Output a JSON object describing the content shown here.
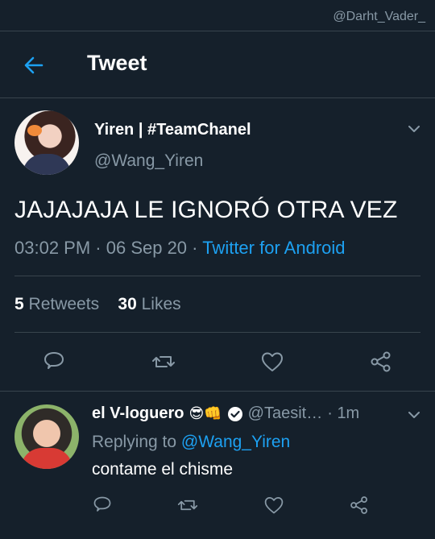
{
  "watermark": "@Darht_Vader_",
  "header": {
    "title": "Tweet"
  },
  "tweet": {
    "author_name": "Yiren | #TeamChanel",
    "author_handle": "@Wang_Yiren",
    "text": "JAJAJAJA LE IGNORÓ OTRA VEZ",
    "time": "03:02 PM",
    "date": "06 Sep 20",
    "source": "Twitter for Android",
    "retweets_count": "5",
    "retweets_label": "Retweets",
    "likes_count": "30",
    "likes_label": "Likes"
  },
  "reply": {
    "author_name": "el V-loguero",
    "emojis": "😎👊",
    "author_handle": "@Taesit…",
    "time": "1m",
    "replying_to_label": "Replying to",
    "replying_to_handle": "@Wang_Yiren",
    "text": "contame el chisme"
  },
  "colors": {
    "background": "#15202b",
    "accent": "#1da1f2",
    "secondary_text": "#8899a6",
    "divider": "#38444d"
  },
  "icons": [
    "back-arrow-icon",
    "chevron-down-icon",
    "reply-icon",
    "retweet-icon",
    "like-icon",
    "share-icon",
    "verified-badge-icon"
  ]
}
